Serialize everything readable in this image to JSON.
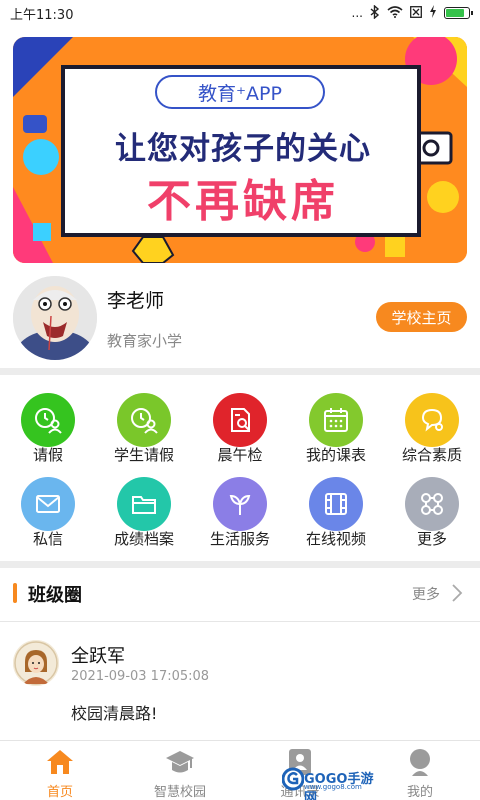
{
  "status_bar": {
    "time": "上午11:30",
    "dots": "...",
    "battery_level": 0.85
  },
  "banner": {
    "pill_text": "教育⁺APP",
    "line1": "让您对孩子的关心",
    "line2": "不再缺席"
  },
  "profile": {
    "name": "李老师",
    "school": "教育家小学",
    "school_button": "学校主页"
  },
  "grid": {
    "items": [
      {
        "label": "请假",
        "icon": "clock-person-icon",
        "color": "#35c41f"
      },
      {
        "label": "学生请假",
        "icon": "clock-person-icon",
        "color": "#7ac72a"
      },
      {
        "label": "晨午检",
        "icon": "document-search-icon",
        "color": "#e0242b"
      },
      {
        "label": "我的课表",
        "icon": "calendar-icon",
        "color": "#83c92d"
      },
      {
        "label": "综合素质",
        "icon": "bulb-chat-icon",
        "color": "#f7c31b"
      },
      {
        "label": "私信",
        "icon": "mail-icon",
        "color": "#6ab6ee"
      },
      {
        "label": "成绩档案",
        "icon": "folder-icon",
        "color": "#23c7a9"
      },
      {
        "label": "生活服务",
        "icon": "plant-icon",
        "color": "#8b7ee6"
      },
      {
        "label": "在线视频",
        "icon": "film-icon",
        "color": "#6a86e8"
      },
      {
        "label": "更多",
        "icon": "nodes-icon",
        "color": "#a8adb9"
      }
    ]
  },
  "class_circle": {
    "title": "班级圈",
    "more": "更多"
  },
  "post": {
    "author": "全跃军",
    "time": "2021-09-03 17:05:08",
    "text": "校园清晨路!"
  },
  "tabbar": {
    "tabs": [
      {
        "label": "首页",
        "icon": "home-icon",
        "active": true
      },
      {
        "label": "智慧校园",
        "icon": "graduation-cap-icon",
        "active": false
      },
      {
        "label": "通讯录",
        "icon": "contacts-icon",
        "active": false
      },
      {
        "label": "我的",
        "icon": "profile-icon",
        "active": false
      }
    ]
  },
  "watermark": {
    "text": "GOGO手游网",
    "url": "www.gogo8.com"
  },
  "colors": {
    "accent": "#f7891f",
    "divider": "#ececec"
  }
}
